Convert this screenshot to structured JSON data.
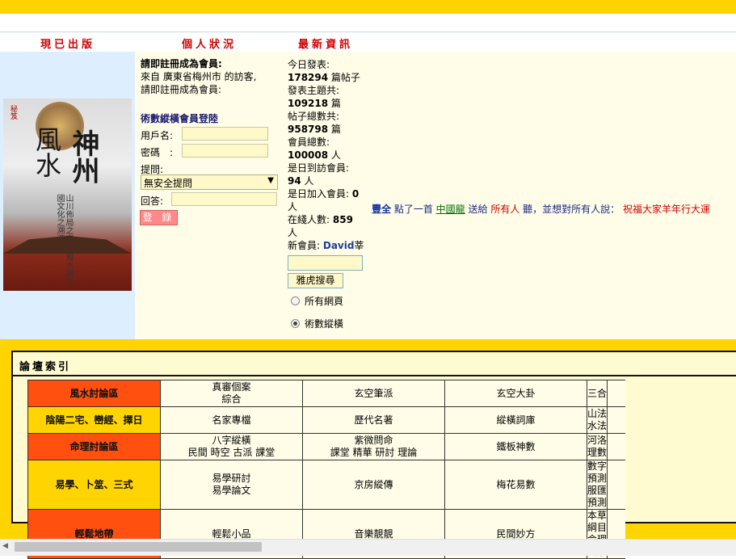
{
  "sections": {
    "published": "現已出版",
    "personal": "個人狀況",
    "news": "最新資訊"
  },
  "book": {
    "title_a": "神州",
    "title_b": "風水",
    "subtitle": "山川佈局之玄機 風水與中國文化之溯源",
    "mark": "秘笈"
  },
  "register": {
    "heading": "請即註冊成為會員:",
    "line1": "來自 廣東省梅州市 的訪客,",
    "line2": "請即註冊成為會員:"
  },
  "login": {
    "title": "術數縱橫會員登陸",
    "user_label": "用戶名:",
    "password_label": "密碼　:",
    "question_label": "提問:",
    "question_value": "無安全提問",
    "answer_label": "回答:",
    "submit": "登 錄"
  },
  "stats": {
    "today_label": "今日發表:",
    "today_value": "178294",
    "today_unit": " 篇帖子",
    "topics_label": "發表主題共:",
    "topics_value": "109218",
    "topics_unit": " 篇",
    "posts_label": "帖子總數共:",
    "posts_value": "958798",
    "posts_unit": " 篇",
    "members_label": "會員總數:",
    "members_value": "100008",
    "members_unit": " 人",
    "visits_label": "是日到訪會員:",
    "visits_value": "94",
    "visits_unit": " 人",
    "joined_label": "是日加入會員:",
    "joined_value": "0",
    "joined_unit": "人",
    "online_label": "在綫人數:",
    "online_value": "859",
    "online_unit": "人",
    "newmember_label": "新會員:",
    "newmember_value": "David",
    "newmember_tail": "莘"
  },
  "search": {
    "button": "雅虎搜尋",
    "option1": "所有網頁",
    "option2": "術數縱橫"
  },
  "marquee": {
    "user": "豐全",
    "t1": " 點了一首 ",
    "song": "中國龍",
    "t2": " 送給 ",
    "target": "所有人",
    "t3": " 聽，並想對所有人說： ",
    "message": "祝福大家羊年行大運"
  },
  "forum": {
    "title": "論壇索引",
    "rows": [
      {
        "category": "風水討論區",
        "style": "orange",
        "cells": [
          [
            "真審個案",
            "綜合"
          ],
          [
            "玄空筆派"
          ],
          [
            "玄空大卦"
          ],
          [
            "三合"
          ]
        ]
      },
      {
        "category": "陰陽二宅、巒經、擇日",
        "style": "yellow",
        "cells": [
          [
            "名家專檔"
          ],
          [
            "歷代名著"
          ],
          [
            "縱橫詞庫"
          ],
          [
            "山法",
            "水法"
          ]
        ]
      },
      {
        "category": "命理討論區",
        "style": "orange",
        "cells": [
          [
            "八字縱橫",
            "民間 時空 古派 課堂"
          ],
          [
            "紫微問命",
            "課堂 精華 研討 理論"
          ],
          [
            "鐵板神數"
          ],
          [
            "河洛理數"
          ]
        ]
      },
      {
        "category": "易學、卜筮、三式",
        "style": "yellow",
        "cells": [
          [
            "易學研討",
            "易學論文"
          ],
          [
            "京房縱傳"
          ],
          [
            "梅花易數"
          ],
          [
            "數字預測",
            "服匯預測"
          ]
        ]
      },
      {
        "category": "輕鬆地帶",
        "style": "orange",
        "cells": [
          [
            "輕鬆小品"
          ],
          [
            "音樂靚靚"
          ],
          [
            "民間妙方"
          ],
          [
            "本草綱目",
            "命理醫學"
          ]
        ]
      }
    ]
  }
}
